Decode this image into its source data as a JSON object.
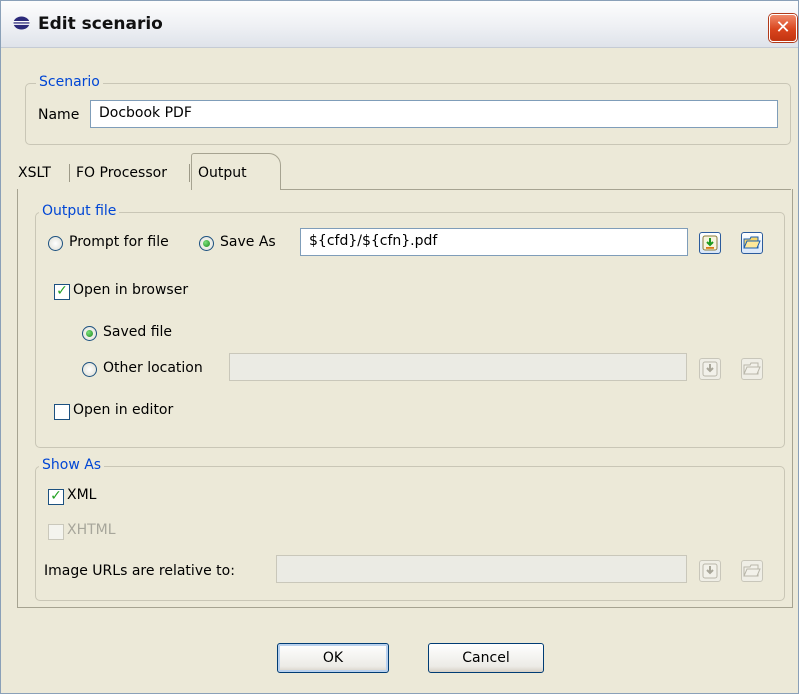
{
  "window": {
    "title": "Edit scenario",
    "close_glyph": "✕"
  },
  "scenario_group": {
    "legend": "Scenario",
    "name_label": "Name",
    "name_value": "Docbook PDF"
  },
  "tabs": [
    {
      "label": "XSLT",
      "active": false
    },
    {
      "label": "FO Processor",
      "active": false
    },
    {
      "label": "Output",
      "active": true
    }
  ],
  "output_file": {
    "legend": "Output file",
    "prompt_label": "Prompt for file",
    "prompt_selected": false,
    "save_as_label": "Save As",
    "save_as_selected": true,
    "save_as_value": "${cfd}/${cfn}.pdf",
    "open_in_browser_label": "Open in browser",
    "open_in_browser_checked": true,
    "saved_file_label": "Saved file",
    "saved_file_selected": true,
    "other_location_label": "Other location",
    "other_location_selected": false,
    "other_location_value": "",
    "open_in_editor_label": "Open in editor",
    "open_in_editor_checked": false
  },
  "show_as": {
    "legend": "Show As",
    "xml_label": "XML",
    "xml_checked": true,
    "xhtml_label": "XHTML",
    "xhtml_checked": false,
    "xhtml_enabled": false,
    "image_urls_label": "Image URLs are relative to:",
    "image_urls_value": ""
  },
  "icons": {
    "insert_variable": "insert-editor-variable-icon",
    "browse": "browse-folder-icon"
  },
  "buttons": {
    "ok": "OK",
    "cancel": "Cancel"
  },
  "colors": {
    "legend": "#0046d5",
    "dialog_bg": "#ece9d8",
    "close": "#d9451e"
  }
}
